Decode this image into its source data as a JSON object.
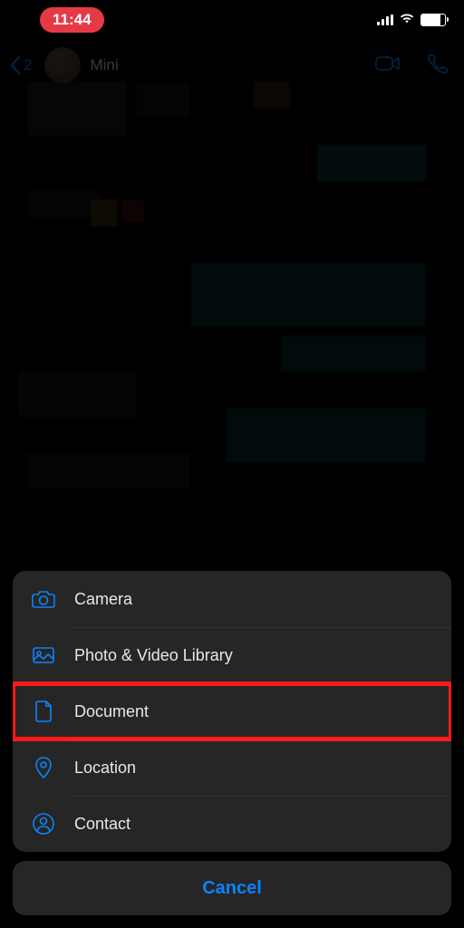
{
  "status": {
    "time": "11:44"
  },
  "chat": {
    "back_count": "2",
    "contact_name": "Mini"
  },
  "sheet": {
    "items": [
      {
        "icon": "camera-icon",
        "label": "Camera"
      },
      {
        "icon": "photo-library-icon",
        "label": "Photo & Video Library"
      },
      {
        "icon": "document-icon",
        "label": "Document"
      },
      {
        "icon": "location-icon",
        "label": "Location"
      },
      {
        "icon": "contact-icon",
        "label": "Contact"
      }
    ],
    "cancel_label": "Cancel"
  },
  "highlight_index": 2
}
